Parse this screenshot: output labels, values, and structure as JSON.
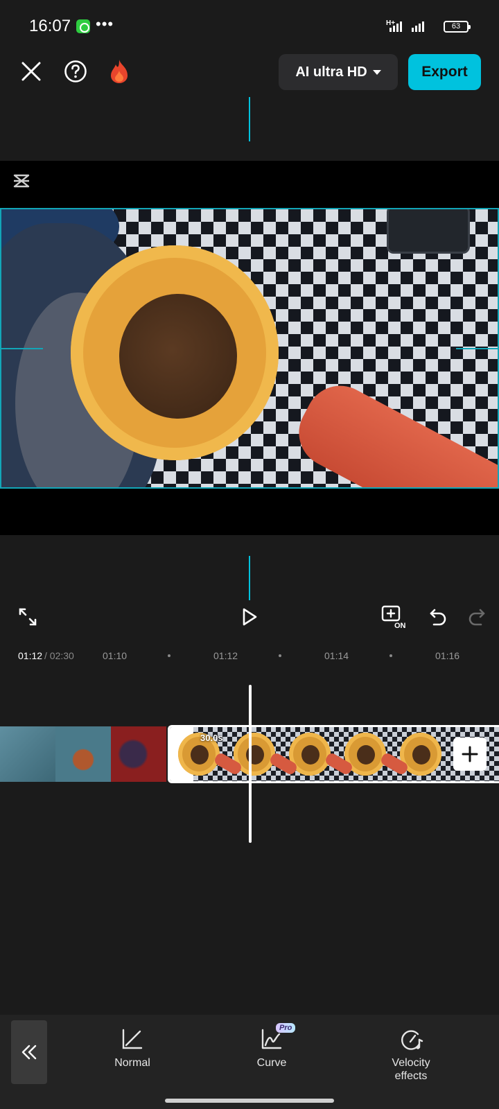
{
  "status_bar": {
    "time": "16:07",
    "network_label": "H+",
    "battery": "63"
  },
  "top_bar": {
    "resolution_label": "AI ultra HD",
    "export_label": "Export"
  },
  "timeline": {
    "current_time": "01:12",
    "total_time": "/ 02:30",
    "ticks": [
      "01:10",
      "01:12",
      "01:14",
      "01:16"
    ],
    "clip_duration": "30.0s"
  },
  "speed_tools": {
    "normal_label": "Normal",
    "curve_label": "Curve",
    "curve_badge": "Pro",
    "velocity_label_line1": "Velocity",
    "velocity_label_line2": "effects"
  },
  "icons": {
    "close": "close-icon",
    "help": "help-icon",
    "fire": "fire-icon",
    "fullscreen": "fullscreen-icon",
    "play": "play-icon",
    "keyframe_on": "keyframe-on-icon",
    "undo": "undo-icon",
    "redo": "redo-icon",
    "add": "plus-icon",
    "back": "double-chevron-left-icon"
  },
  "colors": {
    "accent": "#00c2de",
    "background": "#1b1b1b",
    "panel": "#232323"
  }
}
